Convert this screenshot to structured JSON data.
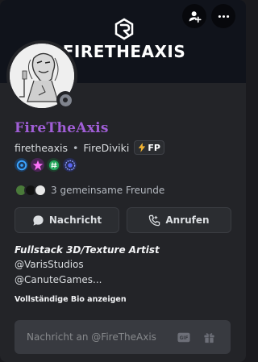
{
  "banner": {
    "brand_text": "FIRETHEAXIS",
    "brand_mark": "R",
    "background_color": "#10131b"
  },
  "header_buttons": {
    "icon_1": "add-friend-icon",
    "icon_2": "more-options-icon"
  },
  "profile": {
    "display_name": "FireTheAxis",
    "username": "firetheaxis",
    "separator": "•",
    "server_name": "FireDiviki",
    "server_tag": "FP",
    "status": "offline",
    "name_color": "#a05ed6"
  },
  "badges": [
    {
      "icon": "hypesquad-icon",
      "color": "#3ba5ff"
    },
    {
      "icon": "nitro-boost-icon",
      "color": "#ff73fa"
    },
    {
      "icon": "hashtag-badge-icon",
      "color": "#23a55a"
    },
    {
      "icon": "quest-badge-icon",
      "color": "#5865f2"
    }
  ],
  "mutuals": {
    "text": "3 gemeinsame Freunde"
  },
  "actions": {
    "message_label": "Nachricht",
    "call_label": "Anrufen"
  },
  "bio": {
    "title": "Fullstack 3D/Texture Artist",
    "line_1": "@VarisStudios",
    "line_2": "@CanuteGames...",
    "show_more": "Vollständige Bio anzeigen"
  },
  "message_input": {
    "placeholder": "Nachricht an @FireTheAxis",
    "gif_label": "GIF"
  }
}
